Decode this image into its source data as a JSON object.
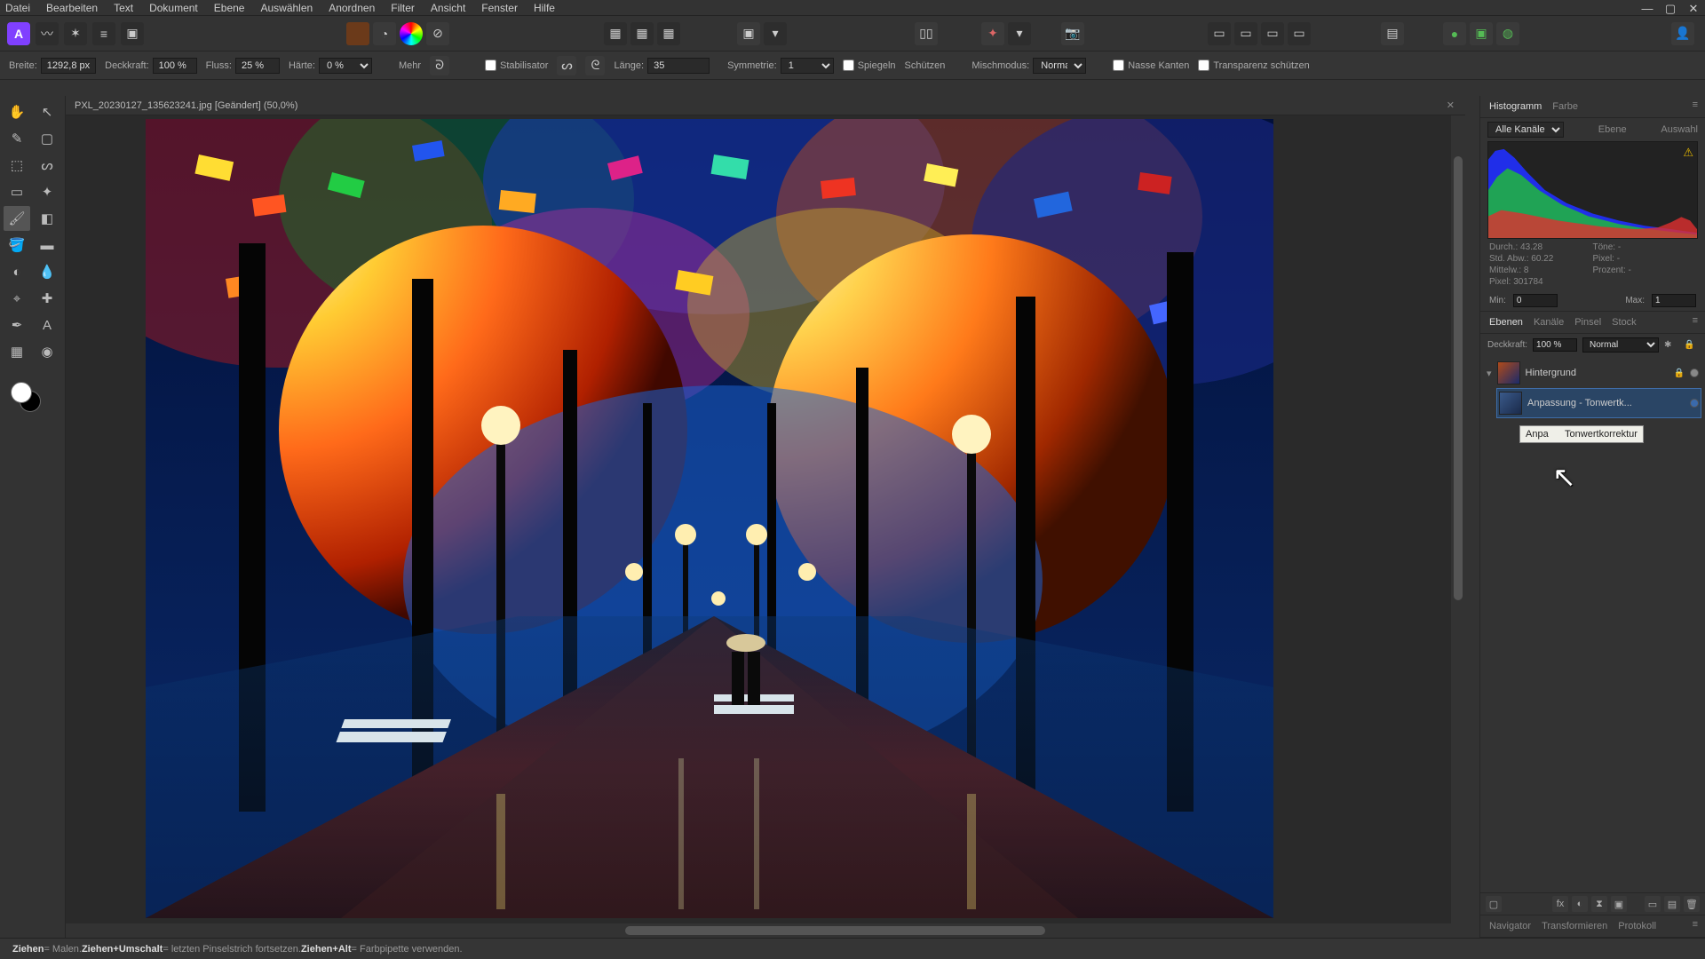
{
  "menu": {
    "items": [
      "Datei",
      "Bearbeiten",
      "Text",
      "Dokument",
      "Ebene",
      "Auswählen",
      "Anordnen",
      "Filter",
      "Ansicht",
      "Fenster",
      "Hilfe"
    ]
  },
  "winctrl": {
    "min": "—",
    "max": "▢",
    "close": "✕"
  },
  "optbar": {
    "breite_label": "Breite:",
    "breite": "1292,8 px",
    "deck_label": "Deckkraft:",
    "deck": "100 %",
    "fluss_label": "Fluss:",
    "fluss": "25 %",
    "haerte_label": "Härte:",
    "haerte": "0 %",
    "mehr": "Mehr",
    "stabil": "Stabilisator",
    "laenge_label": "Länge:",
    "laenge": "35",
    "sym_label": "Symmetrie:",
    "sym": "1",
    "spiegeln": "Spiegeln",
    "schuetzen": "Schützen",
    "misch_label": "Mischmodus:",
    "misch": "Normal",
    "nasse": "Nasse Kanten",
    "trans": "Transparenz schützen"
  },
  "doc": {
    "title": "PXL_20230127_135623241.jpg [Geändert] (50,0%)"
  },
  "hist": {
    "tab1": "Histogramm",
    "tab2": "Farbe",
    "channels": "Alle Kanäle",
    "ebene": "Ebene",
    "auswahl": "Auswahl",
    "s_durch": "Durch.: 43.28",
    "s_toene": "Töne: -",
    "s_std": "Std. Abw.: 60.22",
    "s_pixel": "Pixel: -",
    "s_mittel": "Mittelw.: 8",
    "s_proz": "Prozent: -",
    "s_pixelct": "Pixel: 301784",
    "min_label": "Min:",
    "min": "0",
    "max_label": "Max:",
    "max": "1"
  },
  "layers": {
    "tab1": "Ebenen",
    "tab2": "Kanäle",
    "tab3": "Pinsel",
    "tab4": "Stock",
    "deck_label": "Deckkraft:",
    "deck": "100 %",
    "blend": "Normal",
    "layer1": "Hintergrund",
    "layer2": "Anpassung - Tonwertk...",
    "tooltip_l": "Anpa",
    "tooltip_r": "Tonwertkorrektur"
  },
  "bottomtabs": {
    "t1": "Navigator",
    "t2": "Transformieren",
    "t3": "Protokoll"
  },
  "status": {
    "p1a": "Ziehen",
    "p1b": " = Malen. ",
    "p2a": "Ziehen+Umschalt",
    "p2b": " = letzten Pinselstrich fortsetzen. ",
    "p3a": "Ziehen+Alt",
    "p3b": " = Farbpipette verwenden."
  }
}
